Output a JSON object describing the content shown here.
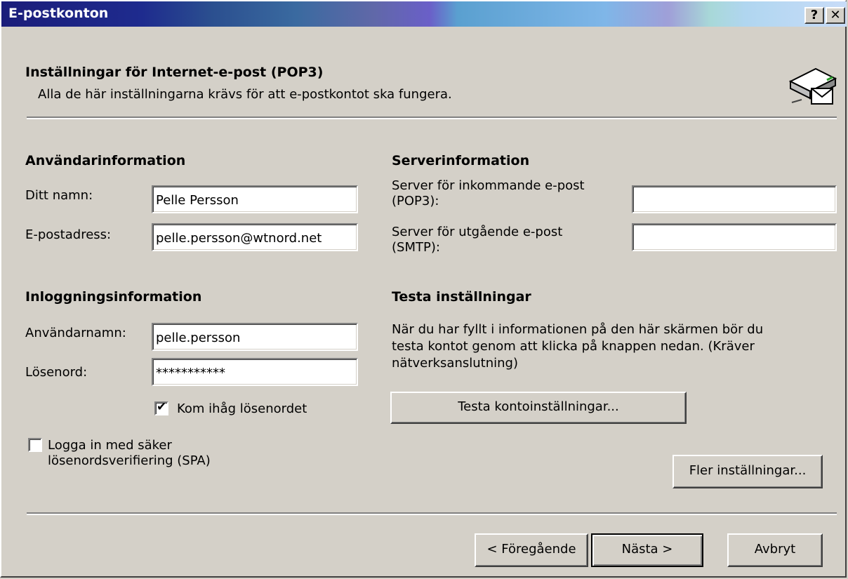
{
  "window": {
    "title": "E-postkonton",
    "help_label": "?",
    "close_label": "✕"
  },
  "header": {
    "title": "Inställningar för Internet-e-post (POP3)",
    "subtitle": "Alla de här inställningarna krävs för att e-postkontot ska fungera.",
    "icon": "mail-server-icon"
  },
  "user_info": {
    "heading": "Användarinformation",
    "name_label": "Ditt namn:",
    "name_value": "Pelle Persson",
    "email_label": "E-postadress:",
    "email_value": "pelle.persson@wtnord.net"
  },
  "server_info": {
    "heading": "Serverinformation",
    "incoming_label_1": "Server för inkommande e-post",
    "incoming_label_2": "(POP3):",
    "incoming_value": "",
    "outgoing_label_1": "Server för utgående e-post",
    "outgoing_label_2": "(SMTP):",
    "outgoing_value": ""
  },
  "login_info": {
    "heading": "Inloggningsinformation",
    "username_label": "Användarnamn:",
    "username_value": "pelle.persson",
    "password_label": "Lösenord:",
    "password_value": "***********",
    "remember_label": "Kom ihåg lösenordet",
    "remember_checked": true,
    "spa_label_1": "Logga in med säker",
    "spa_label_2": "lösenordsverifiering (SPA)",
    "spa_checked": false
  },
  "test": {
    "heading": "Testa inställningar",
    "text_1": "När du har fyllt i informationen på den här skärmen bör du",
    "text_2": "testa kontot genom att klicka på knappen nedan. (Kräver",
    "text_3": "nätverksanslutning)",
    "button_label": "Testa kontoinställningar..."
  },
  "buttons": {
    "more_settings": "Fler inställningar...",
    "back": "< Föregående",
    "next": "Nästa >",
    "cancel": "Avbryt"
  },
  "checkmark": "✔"
}
